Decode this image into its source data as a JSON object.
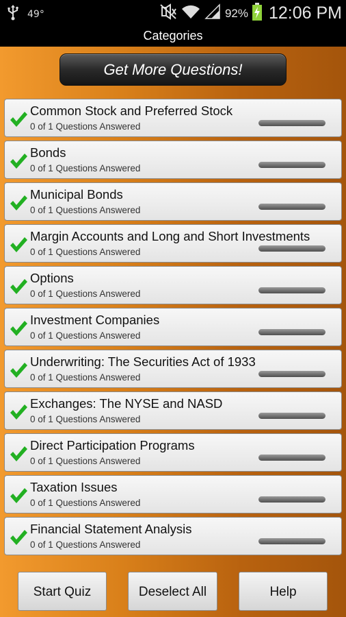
{
  "status_bar": {
    "temperature": "49°",
    "battery_percent": "92%",
    "time": "12:06 PM",
    "icons": [
      "usb-icon",
      "mute-vibrate-icon",
      "wifi-icon",
      "signal-icon",
      "battery-charging-icon"
    ]
  },
  "title": "Categories",
  "get_more_button": "Get More Questions!",
  "categories": [
    {
      "title": "Common Stock and Preferred Stock",
      "subtitle": "0 of 1 Questions Answered",
      "checked": true,
      "progress": 0
    },
    {
      "title": "Bonds",
      "subtitle": "0 of 1 Questions Answered",
      "checked": true,
      "progress": 0
    },
    {
      "title": "Municipal Bonds",
      "subtitle": "0 of 1 Questions Answered",
      "checked": true,
      "progress": 0
    },
    {
      "title": "Margin Accounts and Long and Short Investments",
      "subtitle": "0 of 1 Questions Answered",
      "checked": true,
      "progress": 0
    },
    {
      "title": "Options",
      "subtitle": "0 of 1 Questions Answered",
      "checked": true,
      "progress": 0
    },
    {
      "title": "Investment Companies",
      "subtitle": "0 of 1 Questions Answered",
      "checked": true,
      "progress": 0
    },
    {
      "title": "Underwriting: The Securities Act of 1933",
      "subtitle": "0 of 1 Questions Answered",
      "checked": true,
      "progress": 0
    },
    {
      "title": "Exchanges: The NYSE and NASD",
      "subtitle": "0 of 1 Questions Answered",
      "checked": true,
      "progress": 0
    },
    {
      "title": "Direct Participation Programs",
      "subtitle": "0 of 1 Questions Answered",
      "checked": true,
      "progress": 0
    },
    {
      "title": "Taxation Issues",
      "subtitle": "0 of 1 Questions Answered",
      "checked": true,
      "progress": 0
    },
    {
      "title": "Financial Statement Analysis",
      "subtitle": "0 of 1 Questions Answered",
      "checked": true,
      "progress": 0
    }
  ],
  "buttons": {
    "start_quiz": "Start Quiz",
    "deselect_all": "Deselect All",
    "help": "Help"
  },
  "colors": {
    "check_green": "#22b022",
    "background_orange": "#e08a22"
  }
}
